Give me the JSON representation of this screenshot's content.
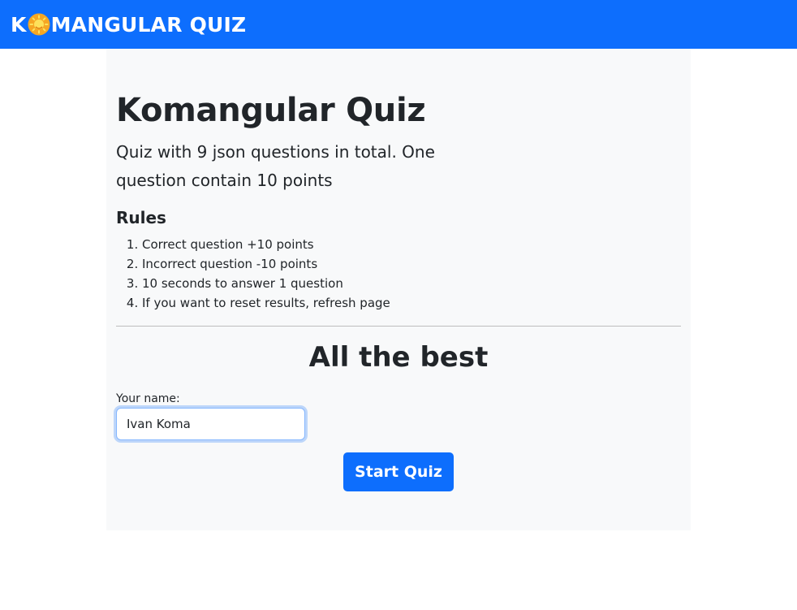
{
  "navbar": {
    "brand_prefix": "K",
    "brand_suffix": "MANGULAR QUIZ",
    "logo_icon": "sun-logo-icon",
    "background": "#0d6efd"
  },
  "intro": {
    "title": "Komangular Quiz",
    "lead": "Quiz with 9 json questions in total. One question contain 10 points"
  },
  "rules": {
    "title": "Rules",
    "items": [
      "Correct question +10 points",
      "Incorrect question -10 points",
      "10 seconds to answer 1 question",
      "If you want to reset results, refresh page"
    ]
  },
  "greeting": "All the best",
  "form": {
    "name_label": "Your name:",
    "name_value": "Ivan Koma",
    "start_label": "Start Quiz"
  },
  "colors": {
    "primary": "#0d6efd",
    "card_bg": "#f8f9fa"
  }
}
